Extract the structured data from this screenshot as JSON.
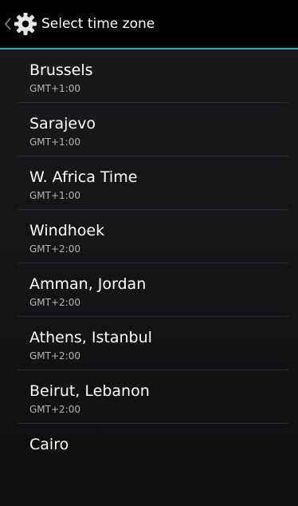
{
  "action_bar": {
    "title": "Select time zone",
    "up_icon": "chevron-left-icon",
    "app_icon": "gear-icon",
    "accent_color": "#33a4c9"
  },
  "time_zones": [
    {
      "name": "Brussels",
      "offset": "GMT+1:00"
    },
    {
      "name": "Sarajevo",
      "offset": "GMT+1:00"
    },
    {
      "name": "W. Africa Time",
      "offset": "GMT+1:00"
    },
    {
      "name": "Windhoek",
      "offset": "GMT+2:00"
    },
    {
      "name": "Amman, Jordan",
      "offset": "GMT+2:00"
    },
    {
      "name": "Athens, Istanbul",
      "offset": "GMT+2:00"
    },
    {
      "name": "Beirut, Lebanon",
      "offset": "GMT+2:00"
    },
    {
      "name": "Cairo",
      "offset": ""
    }
  ]
}
